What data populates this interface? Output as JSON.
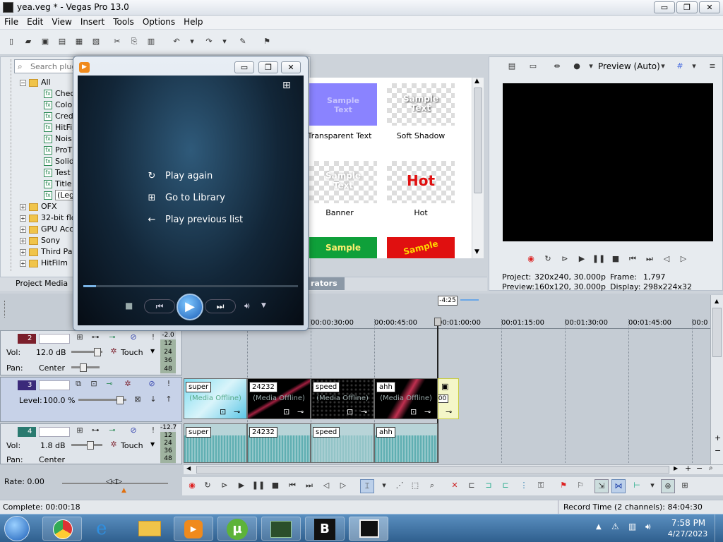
{
  "window": {
    "title": "yea.veg * - Vegas Pro 13.0",
    "min": "▭",
    "max": "❐",
    "close": "✕"
  },
  "menu": [
    "File",
    "Edit",
    "View",
    "Insert",
    "Tools",
    "Options",
    "Help"
  ],
  "search": {
    "placeholder": "Search plug"
  },
  "tree": {
    "all": "All",
    "children": [
      "Chec",
      "Colo",
      "Cred",
      "HitFi",
      "Nois",
      "ProT",
      "Solid",
      "Test",
      "Title",
      "(Leg"
    ],
    "folders": [
      "OFX",
      "32-bit flo",
      "GPU Acc",
      "Sony",
      "Third Pa",
      "HitFilm"
    ]
  },
  "gallery": {
    "tiles": [
      {
        "label": "Transparent Text",
        "text": "Sample Text"
      },
      {
        "label": "Soft Shadow",
        "text": "Sample Text"
      },
      {
        "label": "Banner",
        "text": "Sample Text"
      },
      {
        "label": "Hot",
        "text": "Hot"
      },
      {
        "label": "",
        "text": "Sample"
      },
      {
        "label": "",
        "text": "Sample"
      }
    ]
  },
  "tabs": {
    "project_media": "Project Media",
    "generators": "rators"
  },
  "preview": {
    "mode": "Preview (Auto)",
    "project_label": "Project:",
    "project_value": "320x240, 30.000p",
    "preview_label": "Preview:",
    "preview_value": "160x120, 30.000p",
    "frame_label": "Frame:",
    "frame_value": "1,797",
    "display_label": "Display:",
    "display_value": "298x224x32"
  },
  "wmp": {
    "play_again": "Play again",
    "go_library": "Go to Library",
    "play_prev": "Play previous list"
  },
  "timeline": {
    "cursor_label": "-4:25",
    "ruler": [
      "00:00:30:00",
      "00:00:45:00",
      "00:01:00:00",
      "00:01:15:00",
      "00:01:30:00",
      "00:01:45:00",
      "00:0"
    ],
    "tracks": [
      {
        "num": "2",
        "vol_label": "Vol:",
        "vol": "12.0 dB",
        "pan_label": "Pan:",
        "pan": "Center",
        "mode": "Touch",
        "meter": "-2.0"
      },
      {
        "num": "3",
        "level_label": "Level:",
        "level": "100.0 %"
      },
      {
        "num": "4",
        "vol_label": "Vol:",
        "vol": "1.8 dB",
        "pan_label": "Pan:",
        "pan": "Center",
        "mode": "Touch",
        "meter": "-12.7"
      }
    ],
    "meter_ticks": [
      "12",
      "24",
      "36",
      "48"
    ],
    "video_clips": [
      "super",
      "24232",
      "speed",
      "ahh"
    ],
    "offline": "(Media Offline)",
    "small_clip_time": "0:00",
    "audio_clips": [
      "super",
      "24232",
      "speed",
      "ahh"
    ]
  },
  "rate": "Rate: 0.00",
  "status": {
    "complete": "Complete: 00:00:18",
    "record": "Record Time (2 channels): 84:04:30"
  },
  "clock": {
    "time": "7:58 PM",
    "date": "4/27/2023"
  }
}
